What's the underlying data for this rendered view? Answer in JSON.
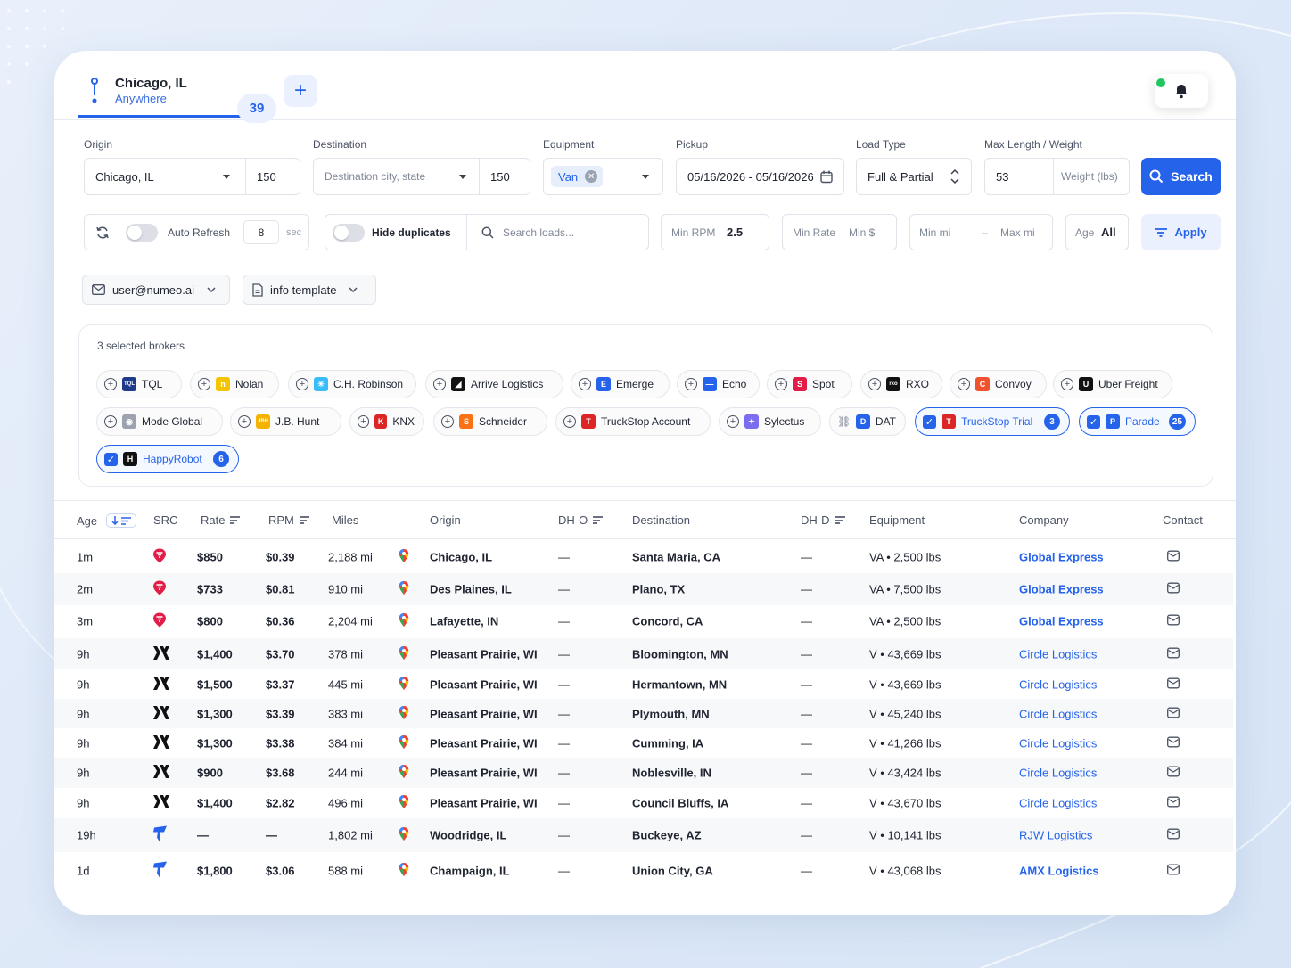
{
  "header": {
    "location_city": "Chicago, IL",
    "location_scope": "Anywhere",
    "result_count": "39",
    "add_tab_label": "+"
  },
  "form": {
    "origin_label": "Origin",
    "origin_value": "Chicago, IL",
    "origin_radius": "150",
    "destination_label": "Destination",
    "destination_placeholder": "Destination city, state",
    "destination_radius": "150",
    "equipment_label": "Equipment",
    "equipment_value": "Van",
    "pickup_label": "Pickup",
    "pickup_value": "05/16/2026 - 05/16/2026",
    "load_type_label": "Load Type",
    "load_type_value": "Full & Partial",
    "max_label": "Max Length / Weight",
    "max_length_value": "53",
    "weight_placeholder": "Weight (lbs)",
    "search_label": "Search"
  },
  "filters": {
    "auto_refresh_label": "Auto Refresh",
    "refresh_interval": "8",
    "refresh_unit": "sec",
    "hide_duplicates_label": "Hide duplicates",
    "search_loads_placeholder": "Search loads...",
    "min_rpm_label": "Min RPM",
    "min_rpm_value": "2.5",
    "min_rate_label": "Min Rate",
    "min_rate_placeholder": "Min $",
    "min_mi_placeholder": "Min mi",
    "range_dash": "–",
    "max_mi_placeholder": "Max mi",
    "age_label": "Age",
    "age_value": "All",
    "apply_label": "Apply"
  },
  "account": {
    "email": "user@numeo.ai",
    "template": "info template"
  },
  "brokers": {
    "title": "3 selected brokers",
    "items": [
      {
        "name": "TQL",
        "logo": "TQL",
        "color": "#1e3a8a",
        "selected": false
      },
      {
        "name": "Nolan",
        "logo": "n",
        "color": "#f5c400",
        "selected": false
      },
      {
        "name": "C.H. Robinson",
        "logo": "✳",
        "color": "#38bdf8",
        "selected": false
      },
      {
        "name": "Arrive Logistics",
        "logo": "◢",
        "color": "#111111",
        "selected": false
      },
      {
        "name": "Emerge",
        "logo": "E",
        "color": "#2563eb",
        "selected": false
      },
      {
        "name": "Echo",
        "logo": "—",
        "color": "#2563eb",
        "selected": false
      },
      {
        "name": "Spot",
        "logo": "S",
        "color": "#e11d48",
        "selected": false
      },
      {
        "name": "RXO",
        "logo": "rxo",
        "color": "#111111",
        "selected": false
      },
      {
        "name": "Convoy",
        "logo": "C",
        "color": "#f0522d",
        "selected": false
      },
      {
        "name": "Uber Freight",
        "logo": "U",
        "color": "#111111",
        "selected": false
      },
      {
        "name": "Mode Global",
        "logo": "◉",
        "color": "#9ca3af",
        "selected": false
      },
      {
        "name": "J.B. Hunt",
        "logo": "JBH",
        "color": "#f5b301",
        "selected": false
      },
      {
        "name": "KNX",
        "logo": "K",
        "color": "#dc2626",
        "selected": false
      },
      {
        "name": "Schneider",
        "logo": "S",
        "color": "#f97316",
        "selected": false
      },
      {
        "name": "TruckStop Account",
        "logo": "T",
        "color": "#dc2626",
        "selected": false
      },
      {
        "name": "Sylectus",
        "logo": "✦",
        "color": "#7c6cf0",
        "selected": false
      },
      {
        "name": "DAT",
        "logo": "D",
        "color": "#2563eb",
        "selected": false,
        "linked": true
      },
      {
        "name": "TruckStop Trial",
        "logo": "T",
        "color": "#dc2626",
        "selected": true,
        "count": "3"
      },
      {
        "name": "Parade",
        "logo": "P",
        "color": "#2563eb",
        "selected": true,
        "count": "25"
      },
      {
        "name": "HappyRobot",
        "logo": "H",
        "color": "#111111",
        "selected": true,
        "count": "6"
      }
    ]
  },
  "table": {
    "columns": [
      "Age",
      "SRC",
      "Rate",
      "RPM",
      "Miles",
      "Origin",
      "DH-O",
      "Destination",
      "DH-D",
      "Equipment",
      "Company",
      "Contact"
    ],
    "rows": [
      {
        "age": "1m",
        "src": "truckstop",
        "rate": "$850",
        "rpm": "$0.39",
        "miles": "2,188 mi",
        "origin": "Chicago, IL",
        "dho": "—",
        "dest": "Santa Maria, CA",
        "dhd": "—",
        "equip": "VA • 2,500 lbs",
        "company": "Global Express",
        "bold_company": true
      },
      {
        "age": "2m",
        "src": "truckstop",
        "rate": "$733",
        "rpm": "$0.81",
        "miles": "910 mi",
        "origin": "Des Plaines, IL",
        "dho": "—",
        "dest": "Plano, TX",
        "dhd": "—",
        "equip": "VA • 7,500 lbs",
        "company": "Global Express",
        "bold_company": true
      },
      {
        "age": "3m",
        "src": "truckstop",
        "rate": "$800",
        "rpm": "$0.36",
        "miles": "2,204 mi",
        "origin": "Lafayette, IN",
        "dho": "—",
        "dest": "Concord, CA",
        "dhd": "—",
        "equip": "VA • 2,500 lbs",
        "company": "Global Express",
        "bold_company": true
      },
      {
        "age": "9h",
        "src": "happyrobot",
        "rate": "$1,400",
        "rpm": "$3.70",
        "miles": "378 mi",
        "origin": "Pleasant Prairie, WI",
        "dho": "—",
        "dest": "Bloomington, MN",
        "dhd": "—",
        "equip": "V • 43,669 lbs",
        "company": "Circle Logistics",
        "bold_company": false
      },
      {
        "age": "9h",
        "src": "happyrobot",
        "rate": "$1,500",
        "rpm": "$3.37",
        "miles": "445 mi",
        "origin": "Pleasant Prairie, WI",
        "dho": "—",
        "dest": "Hermantown, MN",
        "dhd": "—",
        "equip": "V • 43,669 lbs",
        "company": "Circle Logistics",
        "bold_company": false
      },
      {
        "age": "9h",
        "src": "happyrobot",
        "rate": "$1,300",
        "rpm": "$3.39",
        "miles": "383 mi",
        "origin": "Pleasant Prairie, WI",
        "dho": "—",
        "dest": "Plymouth, MN",
        "dhd": "—",
        "equip": "V • 45,240 lbs",
        "company": "Circle Logistics",
        "bold_company": false
      },
      {
        "age": "9h",
        "src": "happyrobot",
        "rate": "$1,300",
        "rpm": "$3.38",
        "miles": "384 mi",
        "origin": "Pleasant Prairie, WI",
        "dho": "—",
        "dest": "Cumming, IA",
        "dhd": "—",
        "equip": "V • 41,266 lbs",
        "company": "Circle Logistics",
        "bold_company": false
      },
      {
        "age": "9h",
        "src": "happyrobot",
        "rate": "$900",
        "rpm": "$3.68",
        "miles": "244 mi",
        "origin": "Pleasant Prairie, WI",
        "dho": "—",
        "dest": "Noblesville, IN",
        "dhd": "—",
        "equip": "V • 43,424 lbs",
        "company": "Circle Logistics",
        "bold_company": false
      },
      {
        "age": "9h",
        "src": "happyrobot",
        "rate": "$1,400",
        "rpm": "$2.82",
        "miles": "496 mi",
        "origin": "Pleasant Prairie, WI",
        "dho": "—",
        "dest": "Council Bluffs, IA",
        "dhd": "—",
        "equip": "V • 43,670 lbs",
        "company": "Circle Logistics",
        "bold_company": false
      },
      {
        "age": "19h",
        "src": "parade",
        "rate": "—",
        "rpm": "—",
        "miles": "1,802 mi",
        "origin": "Woodridge, IL",
        "dho": "—",
        "dest": "Buckeye, AZ",
        "dhd": "—",
        "equip": "V • 10,141 lbs",
        "company": "RJW Logistics",
        "bold_company": false
      },
      {
        "age": "1d",
        "src": "parade",
        "rate": "$1,800",
        "rpm": "$3.06",
        "miles": "588 mi",
        "origin": "Champaign, IL",
        "dho": "—",
        "dest": "Union City, GA",
        "dhd": "—",
        "equip": "V • 43,068 lbs",
        "company": "AMX Logistics",
        "bold_company": true
      }
    ]
  },
  "colors": {
    "accent": "#2563eb",
    "alert": "#22c55e"
  }
}
